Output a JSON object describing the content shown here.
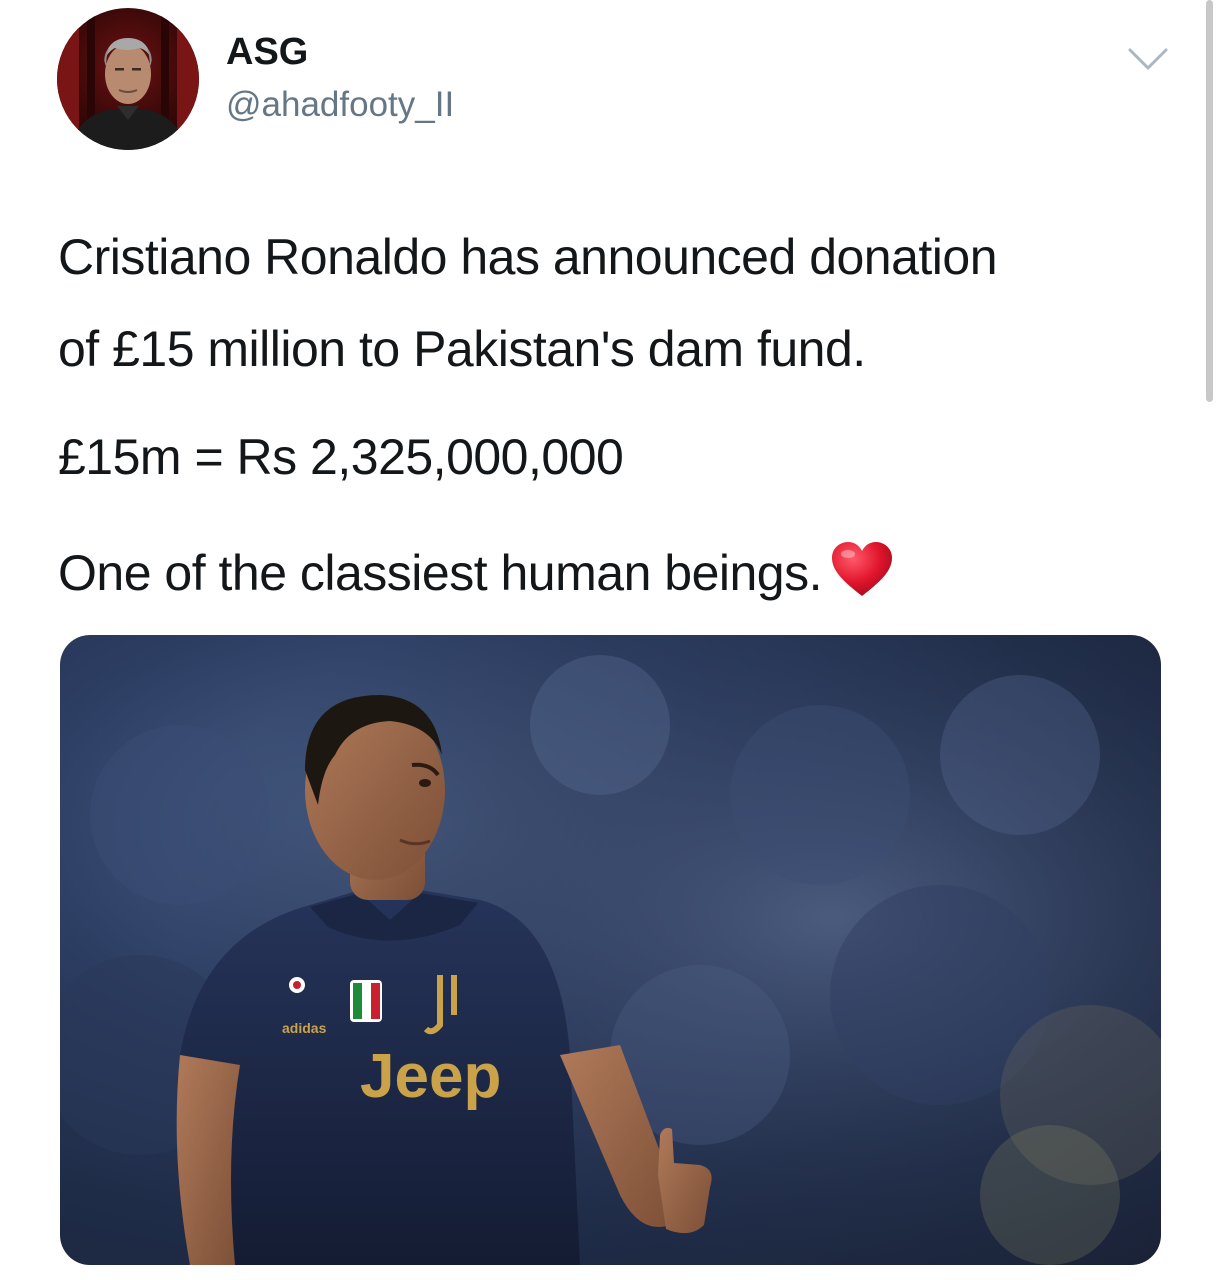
{
  "tweet": {
    "display_name": "ASG",
    "handle": "@ahadfooty_II",
    "text_lines": [
      "Cristiano Ronaldo has announced donation",
      "of £15 million to Pakistan's dam fund.",
      "£15m = Rs 2,325,000,000",
      "One of the classiest human beings."
    ],
    "heart_emoji": "red-heart",
    "media": {
      "jersey_sponsor": "Jeep",
      "kit_brand": "adidas",
      "colors": {
        "jersey": "#1e2a4a",
        "jersey_trim": "#c9a24a",
        "background": "#2c3d62"
      }
    }
  },
  "icons": {
    "menu": "chevron-down-icon",
    "avatar": "avatar"
  },
  "colors": {
    "text": "#14171a",
    "secondary": "#657786",
    "heart": "#e0245e"
  }
}
